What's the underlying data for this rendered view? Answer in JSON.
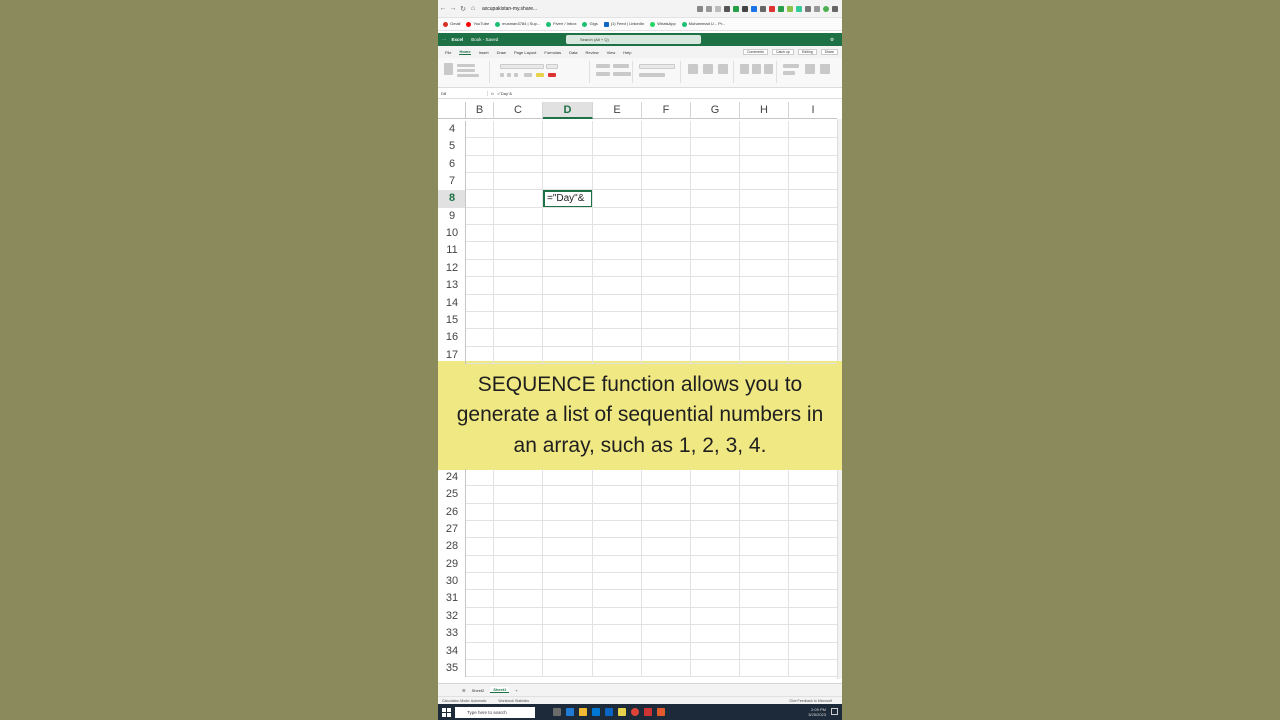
{
  "browser": {
    "url": "axcupakistan-my.share...",
    "bookmarks": [
      "Gmail",
      "YouTube",
      "musman3784 | Sup...",
      "Fiverr / Inbox",
      "Gigs",
      "(1) Feed | LinkedIn",
      "WhatsApp",
      "Muhammad U... Pr..."
    ]
  },
  "excel": {
    "app_name": "Excel",
    "doc_name": "Book - Saved",
    "search_placeholder": "Search (Alt + Q)",
    "tabs": [
      "File",
      "Home",
      "Insert",
      "Draw",
      "Page Layout",
      "Formulas",
      "Data",
      "Review",
      "View",
      "Help"
    ],
    "active_tab": "Home",
    "comments_label": "Comments",
    "catchup_label": "Catch up",
    "editing_label": "Editing",
    "share_label": "Share",
    "name_box": "D8",
    "formula": "=\"Day\"&",
    "columns": [
      "B",
      "C",
      "D",
      "E",
      "F",
      "G",
      "H",
      "I"
    ],
    "active_column": "D",
    "rows_top": [
      "4",
      "5",
      "6",
      "7",
      "8",
      "9",
      "10",
      "11",
      "12",
      "13",
      "14",
      "15",
      "16",
      "17"
    ],
    "rows_bottom": [
      "24",
      "25",
      "26",
      "27",
      "28",
      "29",
      "30",
      "31",
      "32",
      "33",
      "34",
      "35"
    ],
    "active_row": "8",
    "active_cell_text": "=\"Day\"&",
    "sheets": [
      "Sheet2",
      "Sheet1"
    ],
    "active_sheet": "Sheet1",
    "status_left": "Calculation Mode: Automatic",
    "status_mid": "Workbook Statistics",
    "status_right": "Give Feedback to Microsoft"
  },
  "caption": "SEQUENCE function allows you to generate a list of sequential numbers in an array, such as 1, 2, 3, 4.",
  "taskbar": {
    "search_placeholder": "Type here to search",
    "time": "2:09 PM",
    "date": "3/25/2023"
  },
  "colors": {
    "excel_green": "#1e7145",
    "caption_bg": "#f0e883",
    "page_bg": "#8a8a5c"
  }
}
